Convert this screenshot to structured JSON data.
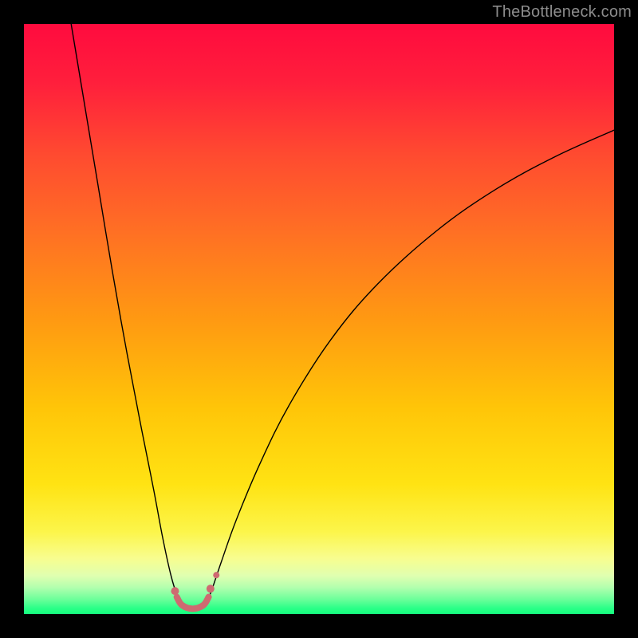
{
  "watermark": "TheBottleneck.com",
  "chart_data": {
    "type": "line",
    "title": "",
    "xlabel": "",
    "ylabel": "",
    "xlim": [
      0,
      100
    ],
    "ylim": [
      0,
      100
    ],
    "grid": false,
    "legend": false,
    "notes": "Background is a vertical color gradient from red at top through orange and yellow to a thin green band at the very bottom. Two black curved lines descend from the top edges and meet near a small cluster of pink dots at the bottom center-left.",
    "background_gradient_stops": [
      {
        "offset": 0.0,
        "color": "#ff0b3e"
      },
      {
        "offset": 0.1,
        "color": "#ff1f3c"
      },
      {
        "offset": 0.22,
        "color": "#ff4a30"
      },
      {
        "offset": 0.35,
        "color": "#ff6f24"
      },
      {
        "offset": 0.5,
        "color": "#ff9912"
      },
      {
        "offset": 0.65,
        "color": "#ffc508"
      },
      {
        "offset": 0.78,
        "color": "#ffe313"
      },
      {
        "offset": 0.86,
        "color": "#fcf54a"
      },
      {
        "offset": 0.905,
        "color": "#f8fd8e"
      },
      {
        "offset": 0.935,
        "color": "#e0ffb0"
      },
      {
        "offset": 0.955,
        "color": "#b2ffae"
      },
      {
        "offset": 0.975,
        "color": "#6cff9a"
      },
      {
        "offset": 0.99,
        "color": "#2bff88"
      },
      {
        "offset": 1.0,
        "color": "#14ff7d"
      }
    ],
    "series": [
      {
        "name": "left-curve",
        "stroke": "#000000",
        "stroke_width": 1.4,
        "points": [
          {
            "x": 8.0,
            "y": 100.0
          },
          {
            "x": 10.0,
            "y": 88.0
          },
          {
            "x": 12.5,
            "y": 73.0
          },
          {
            "x": 15.0,
            "y": 58.0
          },
          {
            "x": 17.5,
            "y": 44.0
          },
          {
            "x": 20.0,
            "y": 31.0
          },
          {
            "x": 22.0,
            "y": 21.0
          },
          {
            "x": 23.5,
            "y": 13.0
          },
          {
            "x": 24.8,
            "y": 7.0
          },
          {
            "x": 25.8,
            "y": 3.5
          },
          {
            "x": 26.5,
            "y": 1.5
          }
        ]
      },
      {
        "name": "right-curve",
        "stroke": "#000000",
        "stroke_width": 1.4,
        "points": [
          {
            "x": 30.8,
            "y": 1.5
          },
          {
            "x": 31.8,
            "y": 4.0
          },
          {
            "x": 33.5,
            "y": 9.0
          },
          {
            "x": 36.0,
            "y": 16.0
          },
          {
            "x": 40.0,
            "y": 25.5
          },
          {
            "x": 45.0,
            "y": 35.5
          },
          {
            "x": 52.0,
            "y": 46.5
          },
          {
            "x": 60.0,
            "y": 56.0
          },
          {
            "x": 70.0,
            "y": 65.0
          },
          {
            "x": 80.0,
            "y": 72.0
          },
          {
            "x": 90.0,
            "y": 77.5
          },
          {
            "x": 100.0,
            "y": 82.0
          }
        ]
      },
      {
        "name": "bottom-arc",
        "stroke": "#ce6a71",
        "stroke_width": 8,
        "points": [
          {
            "x": 25.9,
            "y": 2.9
          },
          {
            "x": 26.8,
            "y": 1.5
          },
          {
            "x": 28.6,
            "y": 0.9
          },
          {
            "x": 30.4,
            "y": 1.5
          },
          {
            "x": 31.3,
            "y": 2.9
          }
        ]
      }
    ],
    "markers": [
      {
        "x": 25.6,
        "y": 3.9,
        "r": 5,
        "color": "#ce6a71"
      },
      {
        "x": 31.6,
        "y": 4.3,
        "r": 5,
        "color": "#ce6a71"
      },
      {
        "x": 32.6,
        "y": 6.6,
        "r": 4,
        "color": "#ce6a71"
      }
    ]
  }
}
